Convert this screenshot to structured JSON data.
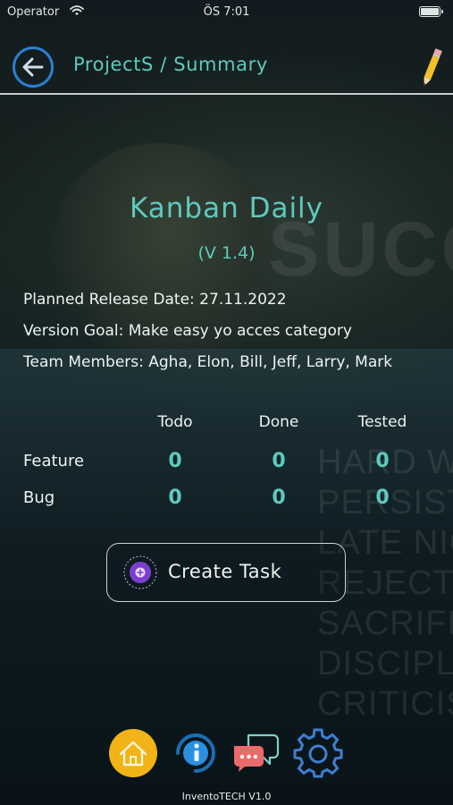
{
  "status_bar": {
    "carrier": "Operator",
    "time": "ÖS 7:01"
  },
  "header": {
    "breadcrumb": "ProjectS / Summary"
  },
  "background": {
    "big_word": "SUCC",
    "motto_lines": [
      "HARD WO",
      "PERSISTEN",
      "LATE NIGH",
      "REJECTIO",
      "SACRIFIC",
      "DISCIPLI",
      "CRITICIS"
    ]
  },
  "project": {
    "name": "Kanban Daily",
    "version": "(V 1.4)",
    "planned_release": "Planned Release Date: 27.11.2022",
    "version_goal": "Version Goal: Make easy yo acces category",
    "team_members": "Team Members: Agha, Elon, Bill, Jeff, Larry, Mark"
  },
  "summary_table": {
    "columns": [
      "Todo",
      "Done",
      "Tested"
    ],
    "rows": [
      {
        "label": "Feature",
        "values": [
          "0",
          "0",
          "0"
        ]
      },
      {
        "label": "Bug",
        "values": [
          "0",
          "0",
          "0"
        ]
      }
    ]
  },
  "create_task": {
    "label": "Create Task"
  },
  "nav": {
    "icons": [
      "home-icon",
      "info-icon",
      "chat-icon",
      "settings-icon"
    ]
  },
  "footer": {
    "text": "InventoTECH V1.0"
  },
  "colors": {
    "accent": "#5fc9bd",
    "home_bg": "#f1b315",
    "purple": "#7a3fd1"
  }
}
